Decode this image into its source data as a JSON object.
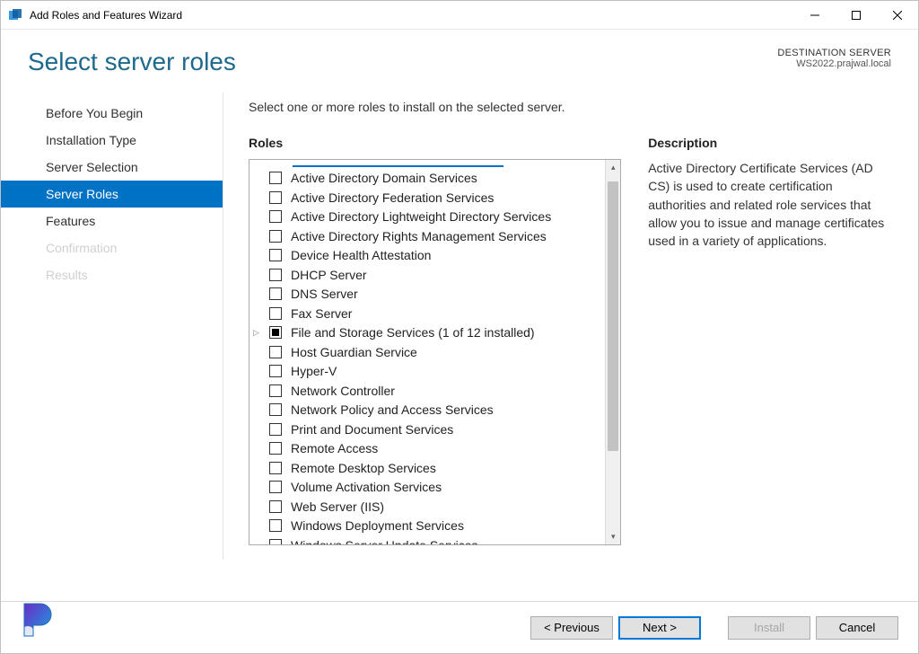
{
  "window": {
    "title": "Add Roles and Features Wizard"
  },
  "header": {
    "page_title": "Select server roles",
    "destination_label": "DESTINATION SERVER",
    "destination_server": "WS2022.prajwal.local"
  },
  "sidebar": {
    "items": [
      {
        "label": "Before You Begin",
        "state": "normal"
      },
      {
        "label": "Installation Type",
        "state": "normal"
      },
      {
        "label": "Server Selection",
        "state": "normal"
      },
      {
        "label": "Server Roles",
        "state": "active"
      },
      {
        "label": "Features",
        "state": "normal"
      },
      {
        "label": "Confirmation",
        "state": "disabled"
      },
      {
        "label": "Results",
        "state": "disabled"
      }
    ]
  },
  "main": {
    "instruction": "Select one or more roles to install on the selected server.",
    "roles_label": "Roles",
    "description_label": "Description",
    "description_text": "Active Directory Certificate Services (AD CS) is used to create certification authorities and related role services that allow you to issue and manage certificates used in a variety of applications.",
    "roles": [
      {
        "label": "Active Directory Domain Services",
        "checked": false
      },
      {
        "label": "Active Directory Federation Services",
        "checked": false
      },
      {
        "label": "Active Directory Lightweight Directory Services",
        "checked": false
      },
      {
        "label": "Active Directory Rights Management Services",
        "checked": false
      },
      {
        "label": "Device Health Attestation",
        "checked": false
      },
      {
        "label": "DHCP Server",
        "checked": false
      },
      {
        "label": "DNS Server",
        "checked": false
      },
      {
        "label": "Fax Server",
        "checked": false
      },
      {
        "label": "File and Storage Services (1 of 12 installed)",
        "checked": "indet",
        "expandable": true
      },
      {
        "label": "Host Guardian Service",
        "checked": false
      },
      {
        "label": "Hyper-V",
        "checked": false
      },
      {
        "label": "Network Controller",
        "checked": false
      },
      {
        "label": "Network Policy and Access Services",
        "checked": false
      },
      {
        "label": "Print and Document Services",
        "checked": false
      },
      {
        "label": "Remote Access",
        "checked": false
      },
      {
        "label": "Remote Desktop Services",
        "checked": false
      },
      {
        "label": "Volume Activation Services",
        "checked": false
      },
      {
        "label": "Web Server (IIS)",
        "checked": false
      },
      {
        "label": "Windows Deployment Services",
        "checked": false
      },
      {
        "label": "Windows Server Update Services",
        "checked": false
      }
    ]
  },
  "footer": {
    "previous": "< Previous",
    "next": "Next >",
    "install": "Install",
    "cancel": "Cancel"
  }
}
